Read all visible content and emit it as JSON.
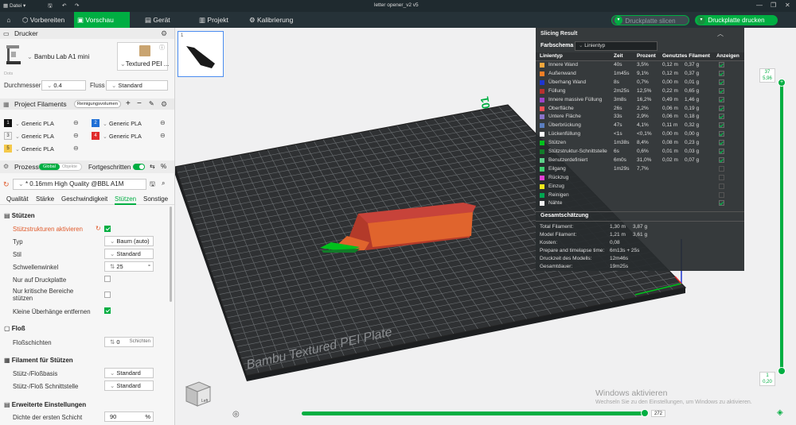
{
  "app": {
    "menu_label": "Datei",
    "title": "letter opener_v2 v5"
  },
  "tabs": [
    "Vorbereiten",
    "Vorschau",
    "Gerät",
    "Projekt",
    "Kalibrierung"
  ],
  "toolbar": {
    "slice_label": "Druckplatte slicen",
    "print_label": "Druckplatte drucken"
  },
  "printer": {
    "section": "Drucker",
    "name": "Bambu Lab A1 mini",
    "plate": "Textured PEI ...",
    "image_caption": "Dots",
    "nozzle_label": "Durchmesser",
    "nozzle_value": "0.4",
    "flow_label": "Fluss",
    "flow_value": "Standard"
  },
  "filaments": {
    "section": "Project Filaments",
    "clean_button": "Reinigungsvolumen",
    "slots": [
      {
        "num": "1",
        "name": "Generic PLA",
        "color": "#111111"
      },
      {
        "num": "2",
        "name": "Generic PLA",
        "color": "#1f6fd6"
      },
      {
        "num": "3",
        "name": "Generic PLA",
        "color": "#f2f2f2"
      },
      {
        "num": "4",
        "name": "Generic PLA",
        "color": "#e02b2b"
      },
      {
        "num": "5",
        "name": "Generic PLA",
        "color": "#f5c94a"
      }
    ]
  },
  "process": {
    "section": "Prozess",
    "global": "Global",
    "object": "Objekte",
    "advanced": "Fortgeschritten",
    "profile": "* 0.16mm High Quality @BBL A1M",
    "subtabs": [
      "Qualität",
      "Stärke",
      "Geschwindigkeit",
      "Stützen",
      "Sonstige"
    ]
  },
  "supports": {
    "title": "Stützen",
    "enable_label": "Stützstrukturen aktivieren",
    "type_label": "Typ",
    "type_value": "Baum (auto)",
    "style_label": "Stil",
    "style_value": "Standard",
    "threshold_label": "Schwellenwinkel",
    "threshold_value": "25",
    "unit_deg": "°",
    "build_plate_label": "Nur auf Druckplatte",
    "critical_label": "Nur kritische Bereiche stützen",
    "remove_small_label": "Kleine Überhänge entfernen"
  },
  "raft": {
    "title": "Floß",
    "layers_label": "Floßschichten",
    "layers_value": "0",
    "layers_unit": "Schichten"
  },
  "support_filament": {
    "title": "Filament für Stützen",
    "base_label": "Stütz-/Floßbasis",
    "base_value": "Standard",
    "interface_label": "Stütz-/Floß Schnittstelle",
    "interface_value": "Standard"
  },
  "advanced": {
    "title": "Erweiterte Einstellungen",
    "density_label": "Dichte der ersten Schicht",
    "density_value": "90",
    "density_unit": "%"
  },
  "plate": {
    "label": "Bambu Textured PEI Plate",
    "number": "01",
    "thumb_index": "1"
  },
  "slider": {
    "top_layer": "37",
    "top_height": "5,96",
    "bottom_layer": "1",
    "bottom_height": "0,20",
    "horizontal_value": "272"
  },
  "watermark": {
    "line1": "Windows aktivieren",
    "line2": "Wechseln Sie zu den Einstellungen, um Windows zu aktivieren."
  },
  "slicing": {
    "title": "Slicing Result",
    "scheme_label": "Farbschema",
    "scheme_value": "Linientyp",
    "headers": [
      "Linientyp",
      "Zeit",
      "Prozent",
      "Genutztes Filament",
      "Anzeigen"
    ],
    "rows": [
      {
        "name": "Innere Wand",
        "time": "40s",
        "pct": "3,5%",
        "len": "0,12 m",
        "wt": "0,37 g",
        "color": "#f4a63c",
        "show": true
      },
      {
        "name": "Außenwand",
        "time": "1m45s",
        "pct": "9,1%",
        "len": "0,12 m",
        "wt": "0,37 g",
        "color": "#f07f27",
        "show": true
      },
      {
        "name": "Überhang Wand",
        "time": "8s",
        "pct": "0,7%",
        "len": "0,00 m",
        "wt": "0,01 g",
        "color": "#1d35d1",
        "show": true
      },
      {
        "name": "Füllung",
        "time": "2m25s",
        "pct": "12,5%",
        "len": "0,22 m",
        "wt": "0,65 g",
        "color": "#b8312f",
        "show": true
      },
      {
        "name": "Innere massive Füllung",
        "time": "3m8s",
        "pct": "16,2%",
        "len": "0,49 m",
        "wt": "1,46 g",
        "color": "#9b44c9",
        "show": true
      },
      {
        "name": "Oberfläche",
        "time": "26s",
        "pct": "2,2%",
        "len": "0,06 m",
        "wt": "0,19 g",
        "color": "#ef4f55",
        "show": true
      },
      {
        "name": "Untere Fläche",
        "time": "33s",
        "pct": "2,9%",
        "len": "0,06 m",
        "wt": "0,18 g",
        "color": "#8a74c9",
        "show": true
      },
      {
        "name": "Überbrückung",
        "time": "47s",
        "pct": "4,1%",
        "len": "0,11 m",
        "wt": "0,32 g",
        "color": "#5b7fc0",
        "show": true
      },
      {
        "name": "Lückenfüllung",
        "time": "<1s",
        "pct": "<0,1%",
        "len": "0,00 m",
        "wt": "0,00 g",
        "color": "#ffffff",
        "show": true
      },
      {
        "name": "Stützen",
        "time": "1m38s",
        "pct": "8,4%",
        "len": "0,08 m",
        "wt": "0,23 g",
        "color": "#00c11c",
        "show": true
      },
      {
        "name": "Stützstruktur-Schnittstelle",
        "time": "6s",
        "pct": "0,6%",
        "len": "0,01 m",
        "wt": "0,03 g",
        "color": "#127b29",
        "show": true
      },
      {
        "name": "Benutzerdefiniert",
        "time": "6m0s",
        "pct": "31,0%",
        "len": "0,02 m",
        "wt": "0,07 g",
        "color": "#5fd18a",
        "show": true
      },
      {
        "name": "Eilgang",
        "time": "1m29s",
        "pct": "7,7%",
        "len": "",
        "wt": "",
        "color": "#3dd06e",
        "show": false
      },
      {
        "name": "Rückzug",
        "time": "",
        "pct": "",
        "len": "",
        "wt": "",
        "color": "#e43fd4",
        "show": false
      },
      {
        "name": "Einzug",
        "time": "",
        "pct": "",
        "len": "",
        "wt": "",
        "color": "#f0e81c",
        "show": false
      },
      {
        "name": "Reinigen",
        "time": "",
        "pct": "",
        "len": "",
        "wt": "",
        "color": "#00a651",
        "show": false
      },
      {
        "name": "Nähte",
        "time": "",
        "pct": "",
        "len": "",
        "wt": "",
        "color": "#f2f2f2",
        "show": true
      }
    ],
    "estimate_title": "Gesamtschätzung",
    "estimates": [
      {
        "label": "Total Filament:",
        "v1": "1,30 m",
        "v2": "3,87 g"
      },
      {
        "label": "Model Filament:",
        "v1": "1,21 m",
        "v2": "3,61 g"
      },
      {
        "label": "Kosten:",
        "v1": "0,08",
        "v2": ""
      },
      {
        "label": "Prepare and timelapse time:",
        "v1": "6m13s + 25s",
        "v2": ""
      },
      {
        "label": "Druckzeit des Modells:",
        "v1": "12m46s",
        "v2": ""
      },
      {
        "label": "Gesamtdauer:",
        "v1": "19m25s",
        "v2": ""
      }
    ]
  }
}
